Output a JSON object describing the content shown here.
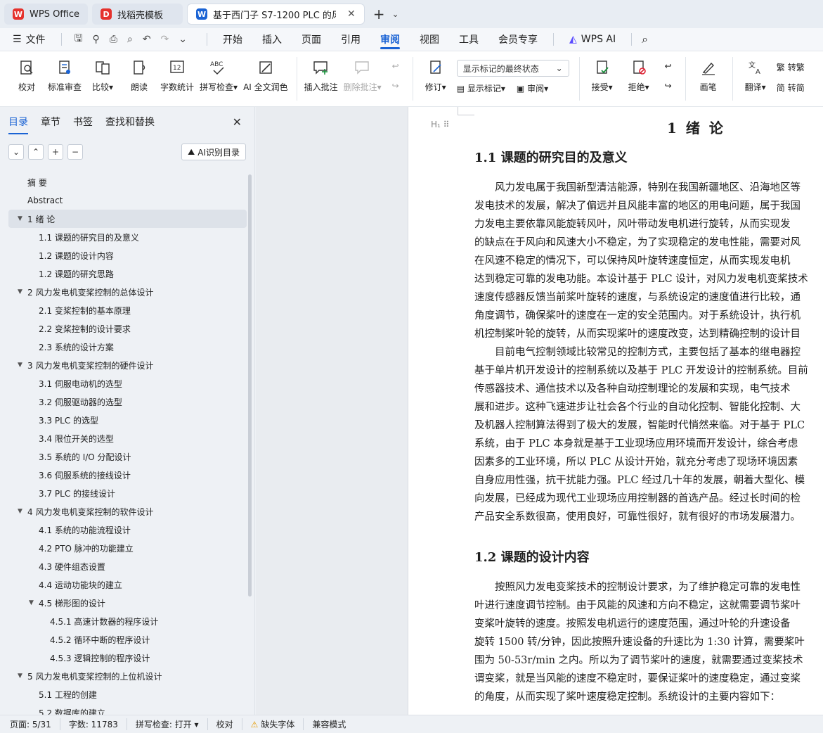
{
  "tabs": [
    {
      "label": "WPS Office",
      "color": "#e5322d",
      "glyph": "W"
    },
    {
      "label": "找稻壳模板",
      "color": "#e5322d",
      "glyph": "D"
    },
    {
      "label": "基于西门子 S7-1200 PLC 的风",
      "color": "#1a63d4",
      "glyph": "W"
    }
  ],
  "menubar": {
    "file": "文件",
    "items": [
      "开始",
      "插入",
      "页面",
      "引用",
      "审阅",
      "视图",
      "工具",
      "会员专享"
    ],
    "active": "审阅",
    "wps_ai": "WPS AI"
  },
  "ribbon": {
    "buttons": [
      {
        "label": "校对",
        "icon": "proofread-icon"
      },
      {
        "label": "标准审查",
        "icon": "standard-review-icon"
      },
      {
        "label": "比较▾",
        "icon": "compare-icon"
      },
      {
        "label": "朗读",
        "icon": "read-aloud-icon"
      },
      {
        "label": "字数统计",
        "icon": "word-count-icon"
      },
      {
        "label": "拼写检查▾",
        "icon": "spell-check-icon"
      },
      {
        "label": "AI 全文润色",
        "icon": "ai-polish-icon"
      },
      {
        "label": "插入批注",
        "icon": "insert-comment-icon"
      },
      {
        "label": "删除批注▾",
        "icon": "delete-comment-icon"
      }
    ],
    "markup_dropdown": "显示标记的最终状态",
    "revise": "修订▾",
    "show_markup": "显示标记▾",
    "review": "审阅▾",
    "accept": "接受▾",
    "reject": "拒绝▾",
    "pen": "画笔",
    "translate": "翻译▾",
    "to_traditional": "转繁",
    "to_simplified": "转简"
  },
  "nav": {
    "tabs": [
      "目录",
      "章节",
      "书签",
      "查找和替换"
    ],
    "active_tab": "目录",
    "ai_toc": "AI识别目录",
    "toc": [
      {
        "label": "摘 要",
        "level": "l1"
      },
      {
        "label": "Abstract",
        "level": "l1"
      },
      {
        "label": "1 绪 论",
        "level": "l1c",
        "caret": true,
        "selected": true
      },
      {
        "label": "1.1 课题的研究目的及意义",
        "level": "l2"
      },
      {
        "label": "1.2 课题的设计内容",
        "level": "l2"
      },
      {
        "label": "1.2 课题的研究思路",
        "level": "l2"
      },
      {
        "label": "2 风力发电机变桨控制的总体设计",
        "level": "l1c",
        "caret": true
      },
      {
        "label": "2.1 变桨控制的基本原理",
        "level": "l2"
      },
      {
        "label": "2.2 变桨控制的设计要求",
        "level": "l2"
      },
      {
        "label": "2.3 系统的设计方案",
        "level": "l2"
      },
      {
        "label": "3 风力发电机变桨控制的硬件设计",
        "level": "l1c",
        "caret": true
      },
      {
        "label": "3.1 伺服电动机的选型",
        "level": "l2"
      },
      {
        "label": "3.2 伺服驱动器的选型",
        "level": "l2"
      },
      {
        "label": "3.3 PLC 的选型",
        "level": "l2"
      },
      {
        "label": "3.4 限位开关的选型",
        "level": "l2"
      },
      {
        "label": "3.5 系统的 I/O 分配设计",
        "level": "l2"
      },
      {
        "label": "3.6 伺服系统的接线设计",
        "level": "l2"
      },
      {
        "label": "3.7 PLC 的接线设计",
        "level": "l2"
      },
      {
        "label": "4 风力发电机变桨控制的软件设计",
        "level": "l1c",
        "caret": true
      },
      {
        "label": "4.1 系统的功能流程设计",
        "level": "l2"
      },
      {
        "label": "4.2 PTO 脉冲的功能建立",
        "level": "l2"
      },
      {
        "label": "4.3 硬件组态设置",
        "level": "l2"
      },
      {
        "label": "4.4 运动功能块的建立",
        "level": "l2"
      },
      {
        "label": "4.5 梯形图的设计",
        "level": "l2c",
        "caret": true
      },
      {
        "label": "4.5.1 高速计数器的程序设计",
        "level": "l3"
      },
      {
        "label": "4.5.2 循环中断的程序设计",
        "level": "l3"
      },
      {
        "label": "4.5.3 逻辑控制的程序设计",
        "level": "l3"
      },
      {
        "label": "5 风力发电机变桨控制的上位机设计",
        "level": "l1c",
        "caret": true
      },
      {
        "label": "5.1 工程的创建",
        "level": "l2"
      },
      {
        "label": "5.2 数据库的建立",
        "level": "l2"
      }
    ]
  },
  "document": {
    "chapter_title": "1 绪 论",
    "gutter_mark": "H₁ ⠿",
    "section1_title": "1.1  课题的研究目的及意义",
    "section1_lines": [
      "　　风力发电属于我国新型清洁能源，特别在我国新疆地区、沿海地区等",
      "发电技术的发展，解决了偏远并且风能丰富的地区的用电问题，属于我国",
      "力发电主要依靠风能旋转风叶，风叶带动发电机进行旋转，从而实现发",
      "的缺点在于风向和风速大小不稳定，为了实现稳定的发电性能，需要对风",
      "在风速不稳定的情况下，可以保持风叶旋转速度恒定，从而实现发电机",
      "达到稳定可靠的发电功能。本设计基于 PLC 设计，对风力发电机变桨技术",
      "速度传感器反馈当前桨叶旋转的速度，与系统设定的速度值进行比较，通",
      "角度调节，确保桨叶的速度在一定的安全范围内。对于系统设计，执行机",
      "机控制桨叶轮的旋转，从而实现桨叶的速度改变，达到精确控制的设计目"
    ],
    "section1_lines2": [
      "　　目前电气控制领域比较常见的控制方式，主要包括了基本的继电器控",
      "基于单片机开发设计的控制系统以及基于 PLC 开发设计的控制系统。目前",
      "传感器技术、通信技术以及各种自动控制理论的发展和实现，电气技术",
      "展和进步。这种飞速进步让社会各个行业的自动化控制、智能化控制、大",
      "及机器人控制算法得到了极大的发展，智能时代悄然来临。对于基于 PLC",
      "系统，由于 PLC 本身就是基于工业现场应用环境而开发设计，综合考虑",
      "因素多的工业环境，所以 PLC 从设计开始，就充分考虑了现场环境因素",
      "自身应用性强，抗干扰能力强。PLC 经过几十年的发展，朝着大型化、模",
      "向发展，已经成为现代工业现场应用控制器的首选产品。经过长时间的检",
      "产品安全系数很高，使用良好，可靠性很好，就有很好的市场发展潜力。"
    ],
    "section2_title": "1.2  课题的设计内容",
    "section2_lines": [
      "　　按照风力发电变桨技术的控制设计要求，为了维护稳定可靠的发电性",
      "叶进行速度调节控制。由于风能的风速和方向不稳定，这就需要调节桨叶",
      "变桨叶旋转的速度。按照发电机运行的速度范围，通过叶轮的升速设备",
      "旋转 1500 转/分钟，因此按照升速设备的升速比为 1:30 计算，需要桨叶",
      "围为 50-53r/min 之内。所以为了调节桨叶的速度，就需要通过变桨技术",
      "谓变桨，就是当风能的速度不稳定时，要保证桨叶的速度稳定，通过变桨",
      "的角度，从而实现了桨叶速度稳定控制。系统设计的主要内容如下："
    ]
  },
  "status": {
    "page": "页面: 5/31",
    "words": "字数: 11783",
    "spell": "拼写检查: 打开 ▾",
    "proof": "校对",
    "missing_font": "缺失字体",
    "compat": "兼容模式"
  }
}
